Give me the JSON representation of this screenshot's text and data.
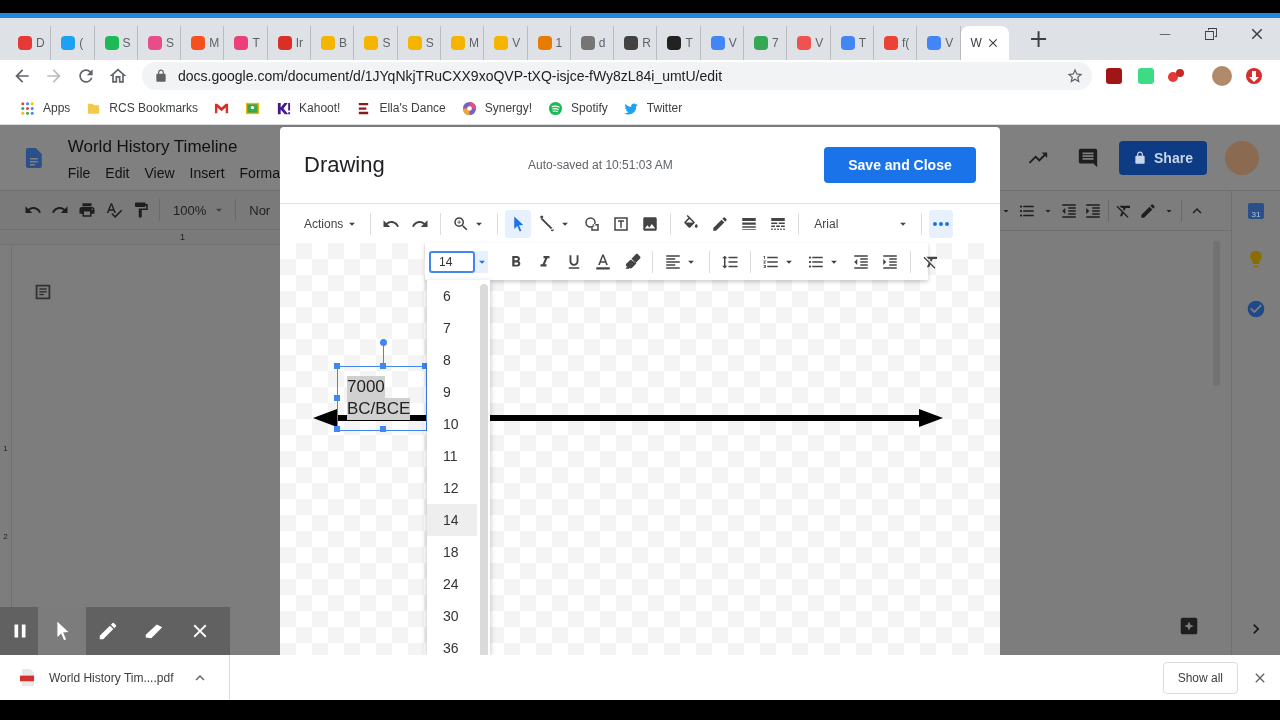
{
  "browser": {
    "tabs": [
      {
        "label": "D",
        "selected": false,
        "color": "#e53935"
      },
      {
        "label": "(",
        "selected": false,
        "color": "#1da1f2"
      },
      {
        "label": "S",
        "selected": false,
        "color": "#1db954"
      },
      {
        "label": "S",
        "selected": false,
        "color": "#e84c8b"
      },
      {
        "label": "M",
        "selected": false,
        "color": "#f4511e"
      },
      {
        "label": "T",
        "selected": false,
        "color": "#ec407a"
      },
      {
        "label": "Ir",
        "selected": false,
        "color": "#d93025"
      },
      {
        "label": "B",
        "selected": false,
        "color": "#f4b400"
      },
      {
        "label": "S",
        "selected": false,
        "color": "#f4b400"
      },
      {
        "label": "S",
        "selected": false,
        "color": "#f4b400"
      },
      {
        "label": "M",
        "selected": false,
        "color": "#f4b400"
      },
      {
        "label": "V",
        "selected": false,
        "color": "#f4b400"
      },
      {
        "label": "1",
        "selected": false,
        "color": "#e67c00"
      },
      {
        "label": "d",
        "selected": false,
        "color": "#757575"
      },
      {
        "label": "R",
        "selected": false,
        "color": "#424242"
      },
      {
        "label": "T",
        "selected": false,
        "color": "#222222"
      },
      {
        "label": "V",
        "selected": false,
        "color": "#4285f4"
      },
      {
        "label": "7",
        "selected": false,
        "color": "#34a853"
      },
      {
        "label": "V",
        "selected": false,
        "color": "#ef5350"
      },
      {
        "label": "T",
        "selected": false,
        "color": "#4285f4"
      },
      {
        "label": "f(",
        "selected": false,
        "color": "#ea4335"
      },
      {
        "label": "V",
        "selected": false,
        "color": "#4285f4"
      },
      {
        "label": "W",
        "selected": true
      }
    ],
    "new_tab": "+",
    "url": "docs.google.com/document/d/1JYqNkjTRuCXX9xoQVP-tXQ-isjce-fWy8zL84i_umtU/edit",
    "bookmarks": [
      {
        "kind": "apps",
        "label": "Apps"
      },
      {
        "kind": "folder",
        "label": "RCS Bookmarks"
      },
      {
        "kind": "gmail"
      },
      {
        "kind": "classroom"
      },
      {
        "kind": "kahoot",
        "label": "Kahoot!"
      },
      {
        "kind": "dance",
        "label": "Ella's Dance"
      },
      {
        "kind": "synergy",
        "label": "Synergy!"
      },
      {
        "kind": "spotify",
        "label": "Spotify"
      },
      {
        "kind": "twitter",
        "label": "Twitter"
      }
    ]
  },
  "docs": {
    "title": "World History Timeline",
    "menu": [
      "File",
      "Edit",
      "View",
      "Insert",
      "Forma"
    ],
    "zoom": "100%",
    "style": "Nor",
    "ruler_mark": "1",
    "page_marks": [
      "1",
      "2"
    ],
    "share": "Share",
    "calendar": "31"
  },
  "drawing": {
    "title": "Drawing",
    "status": "Auto-saved at 10:51:03 AM",
    "save_button": "Save and Close",
    "actions_menu": "Actions",
    "tool_groups": [
      [
        {
          "kind": "undo",
          "selected": false
        },
        {
          "kind": "redo",
          "selected": false
        }
      ],
      [
        {
          "kind": "zoom",
          "selected": false
        }
      ],
      [
        {
          "kind": "select",
          "selected": true
        },
        {
          "kind": "line",
          "selected": false
        },
        {
          "kind": "shape",
          "selected": false
        },
        {
          "kind": "textbox",
          "selected": false
        },
        {
          "kind": "image",
          "selected": false
        }
      ],
      [
        {
          "kind": "fill",
          "selected": false
        },
        {
          "kind": "pen",
          "selected": false
        },
        {
          "kind": "weight",
          "selected": false
        },
        {
          "kind": "dash",
          "selected": false
        }
      ]
    ],
    "font": "Arial",
    "more": {
      "selected": true
    },
    "format": {
      "font_size": "14",
      "tool_groups": [
        [
          {
            "kind": "bold"
          },
          {
            "kind": "italic"
          },
          {
            "kind": "underline"
          },
          {
            "kind": "color"
          },
          {
            "kind": "highlight"
          }
        ],
        [
          {
            "kind": "align"
          }
        ],
        [
          {
            "kind": "spacing"
          }
        ],
        [
          {
            "kind": "numbered"
          },
          {
            "kind": "bulleted"
          },
          {
            "kind": "outdent"
          },
          {
            "kind": "indent"
          }
        ],
        [
          {
            "kind": "clear"
          }
        ]
      ]
    },
    "size_options": [
      {
        "label": "6",
        "selected": false
      },
      {
        "label": "7",
        "selected": false
      },
      {
        "label": "8",
        "selected": false
      },
      {
        "label": "9",
        "selected": false
      },
      {
        "label": "10",
        "selected": false
      },
      {
        "label": "11",
        "selected": false
      },
      {
        "label": "12",
        "selected": false
      },
      {
        "label": "14",
        "selected": true
      },
      {
        "label": "18",
        "selected": false
      },
      {
        "label": "24",
        "selected": false
      },
      {
        "label": "30",
        "selected": false
      },
      {
        "label": "36",
        "selected": false
      }
    ],
    "text_box": {
      "lines": [
        "7000",
        "BC/BCE"
      ],
      "selected": true
    }
  },
  "recorder": {
    "tools": [
      {
        "kind": "pause",
        "selected": false
      },
      {
        "kind": "pointer",
        "selected": true
      },
      {
        "kind": "pen",
        "selected": false
      },
      {
        "kind": "eraser",
        "selected": false
      },
      {
        "kind": "close",
        "selected": false
      }
    ]
  },
  "downloads": {
    "file": "World History Tim....pdf",
    "show_all": "Show all"
  }
}
